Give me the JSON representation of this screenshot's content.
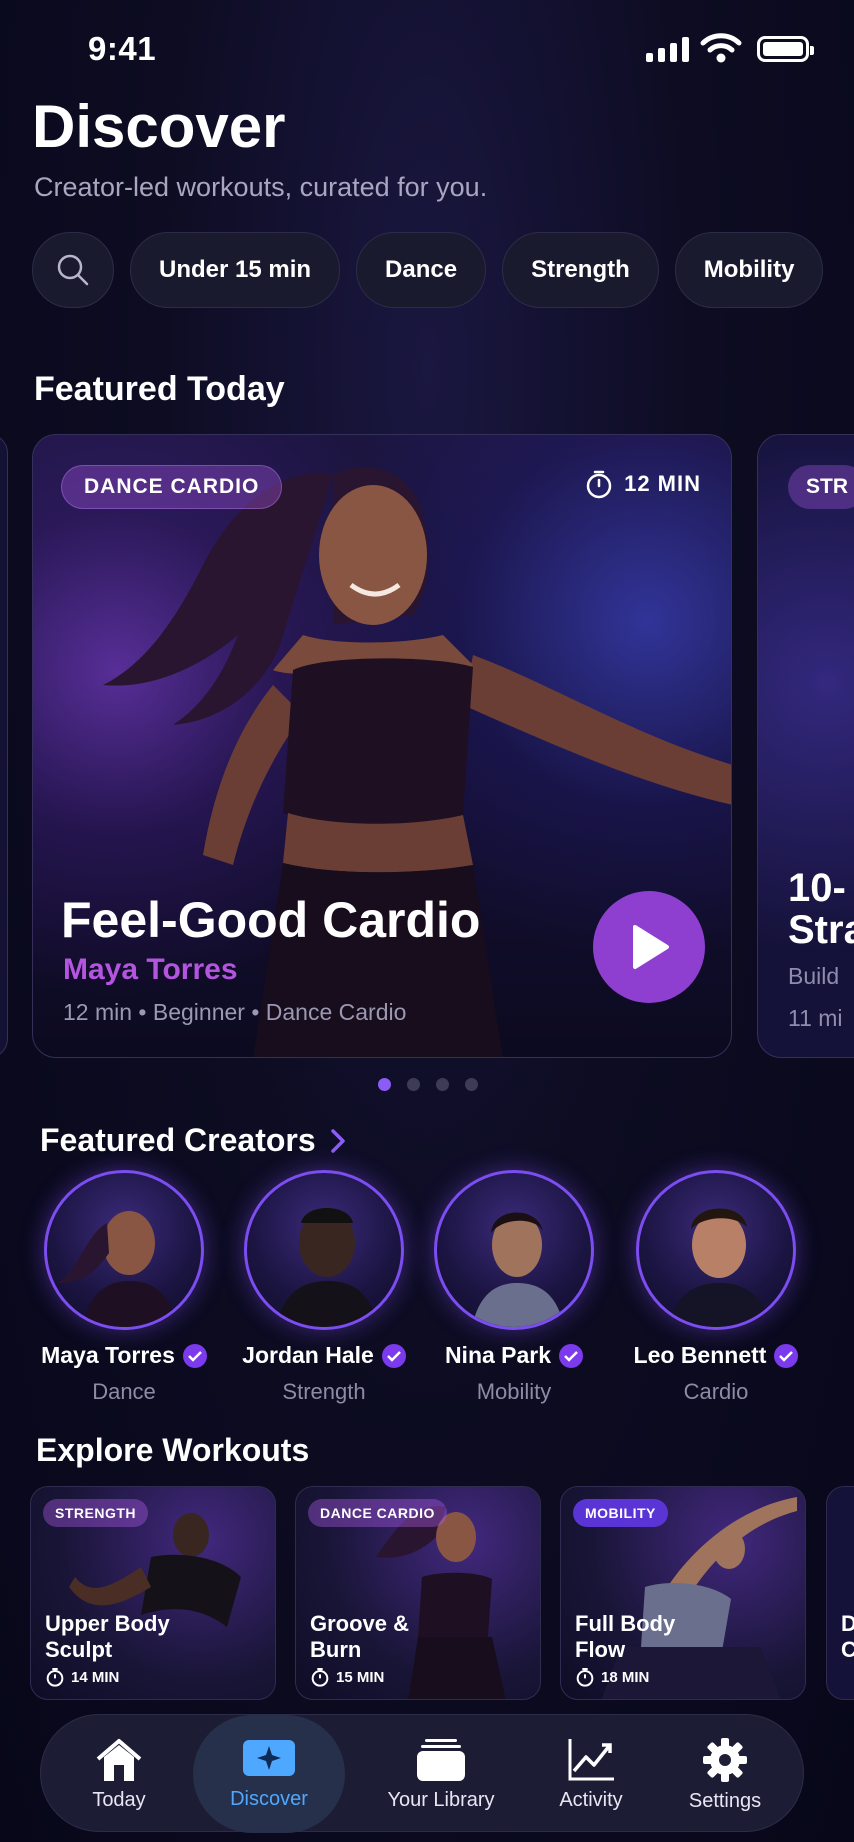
{
  "status": {
    "time": "9:41"
  },
  "header": {
    "title": "Discover",
    "subtitle": "Creator-led workouts, curated for you."
  },
  "filters": [
    "Under 15 min",
    "Dance",
    "Strength",
    "Mobility"
  ],
  "featured": {
    "heading": "Featured Today",
    "main": {
      "tag": "DANCE CARDIO",
      "duration": "12 MIN",
      "title": "Feel-Good Cardio",
      "creator": "Maya Torres",
      "meta": "12 min • Beginner • Dance Cardio"
    },
    "next": {
      "tag": "STR",
      "title": "10-",
      "title2": "Stra",
      "subtitle": "Build",
      "meta": "11 mi"
    }
  },
  "carousel": {
    "total": 4,
    "active": 1
  },
  "creators": {
    "heading": "Featured Creators",
    "items": [
      {
        "name": "Maya Torres",
        "category": "Dance"
      },
      {
        "name": "Jordan Hale",
        "category": "Strength"
      },
      {
        "name": "Nina Park",
        "category": "Mobility"
      },
      {
        "name": "Leo Bennett",
        "category": "Cardio"
      }
    ]
  },
  "explore": {
    "heading": "Explore Workouts",
    "items": [
      {
        "tag": "STRENGTH",
        "title": "Upper Body",
        "title2": "Sculpt",
        "duration": "14 MIN"
      },
      {
        "tag": "DANCE CARDIO",
        "title": "Groove &",
        "title2": "Burn",
        "duration": "15 MIN"
      },
      {
        "tag": "MOBILITY",
        "title": "Full Body",
        "title2": "Flow",
        "duration": "18 MIN"
      }
    ],
    "peek": {
      "title": "D",
      "title2": "C"
    }
  },
  "tabbar": {
    "today": "Today",
    "discover": "Discover",
    "library": "Your Library",
    "activity": "Activity",
    "settings": "Settings",
    "active": "Discover"
  },
  "colors": {
    "accent": "#8e3fd0",
    "creator_text": "#b455e0",
    "tab_active": "#4ea8ff",
    "verified": "#7c3aed"
  }
}
